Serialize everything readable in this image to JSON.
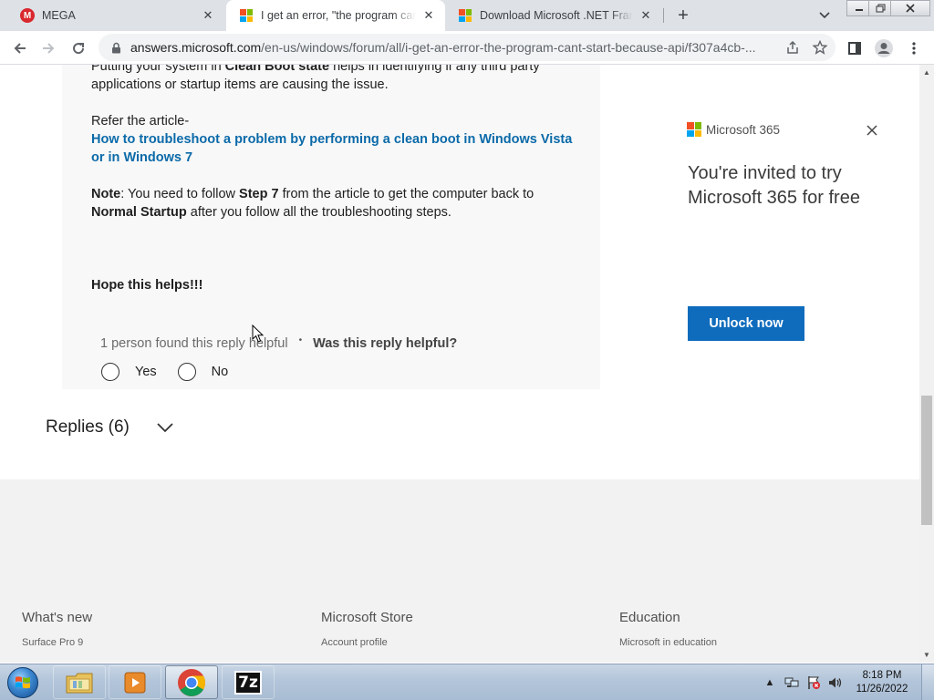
{
  "browser": {
    "tabs": [
      {
        "title": "MEGA",
        "favicon": "mega-icon",
        "active": false
      },
      {
        "title": "I get an error, \"the program can't start because api...",
        "favicon": "microsoft-icon",
        "active": true
      },
      {
        "title": "Download Microsoft .NET Framework",
        "favicon": "microsoft-icon",
        "active": false
      }
    ],
    "new_tab_label": "+",
    "address": {
      "host": "answers.microsoft.com",
      "path": "/en-us/windows/forum/all/i-get-an-error-the-program-cant-start-because-api/f307a4cb-..."
    }
  },
  "answer": {
    "p1_lead": "Putting your system in ",
    "p1_bold": "Clean Boot state",
    "p1_tail": " helps in identifying if any third party applications or startup items are causing the issue.",
    "refer": "Refer the article-",
    "link_text": "How to troubleshoot a problem by performing a clean boot in Windows Vista or in Windows 7",
    "note_label": "Note",
    "note_a": ": You need to follow ",
    "note_b": "Step 7",
    "note_c": " from the article to get the computer back to ",
    "note_d": "Normal Startup",
    "note_e": " after you follow all the troubleshooting steps.",
    "closing": "Hope this helps!!!",
    "helpful_count": "1 person found this reply helpful",
    "helpful_question": "Was this reply helpful?",
    "yes_label": "Yes",
    "no_label": "No"
  },
  "replies": {
    "label": "Replies (6)"
  },
  "ad": {
    "brand": "Microsoft 365",
    "heading": "You're invited to try Microsoft 365 for free",
    "button": "Unlock now",
    "button_color": "#0f6cbd"
  },
  "footer": {
    "columns": [
      {
        "heading": "What's new",
        "link": "Surface Pro 9"
      },
      {
        "heading": "Microsoft Store",
        "link": "Account profile"
      },
      {
        "heading": "Education",
        "link": "Microsoft in education"
      }
    ]
  },
  "taskbar": {
    "apps": [
      "windows-explorer-icon",
      "media-player-icon",
      "chrome-icon",
      "7zip-icon"
    ],
    "seven_zip_label": "7z",
    "time": "8:18 PM",
    "date": "11/26/2022"
  },
  "colors": {
    "link": "#0b6aa9",
    "ms_red": "#f25022",
    "ms_green": "#7fba00",
    "ms_blue": "#00a4ef",
    "ms_yellow": "#ffb900"
  }
}
